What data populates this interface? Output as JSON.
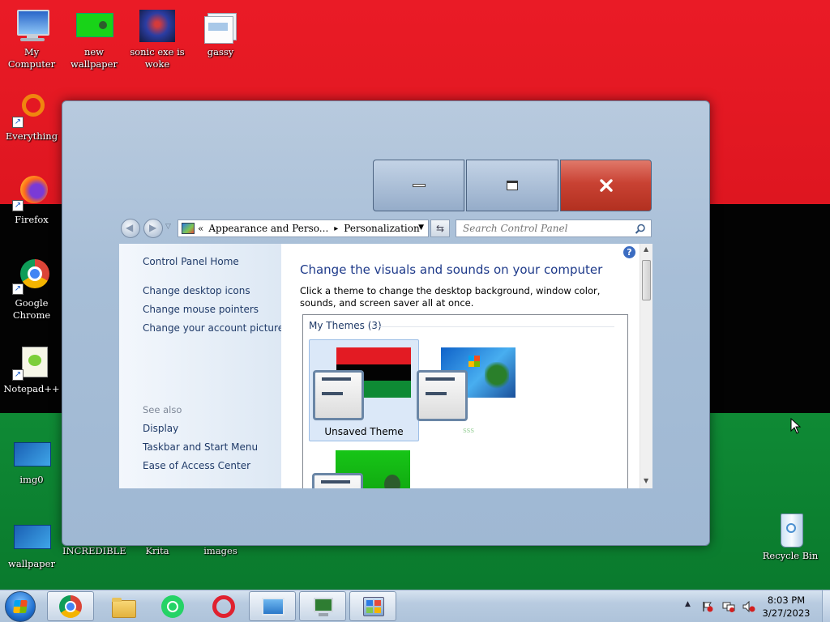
{
  "desktop": {
    "background_colors": {
      "top": "#e31b23",
      "middle": "#000000",
      "bottom": "#0e8a34"
    },
    "icons": [
      {
        "name": "my-computer",
        "label": "My Computer"
      },
      {
        "name": "new-wallpaper",
        "label": "new wallpaper"
      },
      {
        "name": "sonic-exe-is-woke",
        "label": "sonic exe is woke"
      },
      {
        "name": "gassy",
        "label": "gassy"
      },
      {
        "name": "everything",
        "label": "Everything"
      },
      {
        "name": "firefox",
        "label": "Firefox"
      },
      {
        "name": "google-chrome",
        "label": "Google Chrome"
      },
      {
        "name": "notepad-plus-plus",
        "label": "Notepad++"
      },
      {
        "name": "img0",
        "label": "img0"
      },
      {
        "name": "wallpaper",
        "label": "wallpaper"
      },
      {
        "name": "incredible",
        "label": "INCREDIBLE"
      },
      {
        "name": "krita",
        "label": "Krita"
      },
      {
        "name": "images",
        "label": "images"
      },
      {
        "name": "recycle-bin",
        "label": "Recycle Bin"
      }
    ]
  },
  "window": {
    "address": {
      "prefix": "«",
      "segment1": "Appearance and Perso...",
      "separator": "▸",
      "segment2": "Personalization"
    },
    "search_placeholder": "Search Control Panel",
    "left_pane": {
      "home": "Control Panel Home",
      "links": [
        "Change desktop icons",
        "Change mouse pointers",
        "Change your account picture"
      ],
      "see_also_title": "See also",
      "see_also": [
        "Display",
        "Taskbar and Start Menu",
        "Ease of Access Center"
      ]
    },
    "main": {
      "heading": "Change the visuals and sounds on your computer",
      "description": "Click a theme to change the desktop background, window color, sounds, and screen saver all at once.",
      "my_themes_label": "My Themes (3)",
      "themes": [
        {
          "label": "Unsaved Theme",
          "selected": true
        },
        {
          "label": "sss",
          "selected": false
        },
        {
          "label": "",
          "selected": false
        }
      ]
    },
    "help_glyph": "?"
  },
  "taskbar": {
    "items": [
      "start",
      "chrome",
      "file-explorer",
      "whatsapp",
      "opera",
      "photo-viewer",
      "screen-app",
      "control-panel"
    ],
    "clock_time": "8:03 PM",
    "clock_date": "3/27/2023"
  }
}
